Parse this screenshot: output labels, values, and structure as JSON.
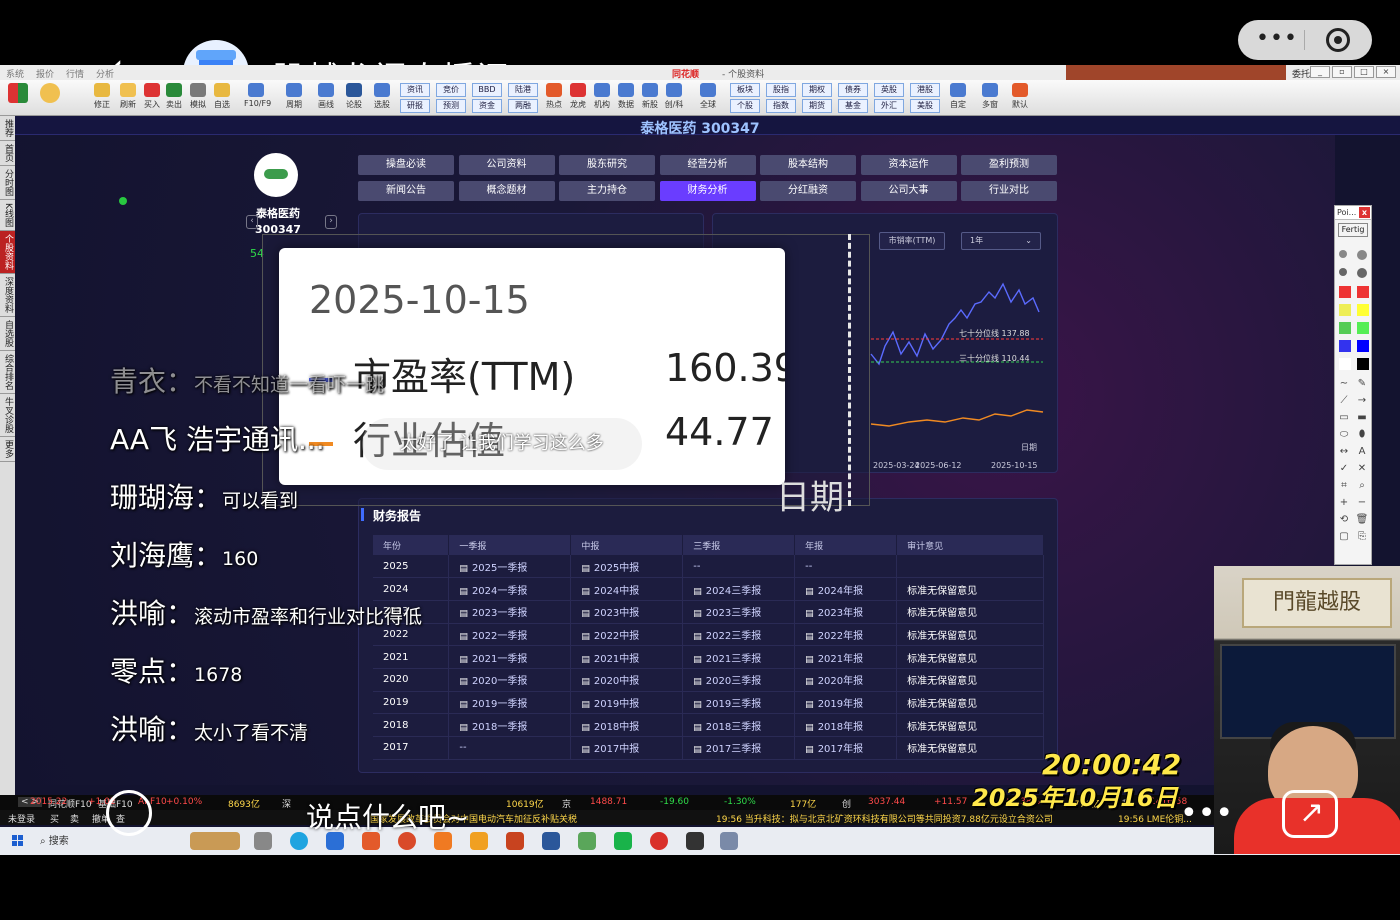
{
  "live": {
    "room_title": "股越龙门直播间",
    "say_prompt": "说点什么吧~",
    "clock_time": "20:00:42",
    "clock_date": "2025年10月16日",
    "cam_plaque": "門龍越股"
  },
  "app": {
    "menu_items": [
      "系统",
      "报价",
      "行情",
      "分析",
      "交易",
      "机会",
      "资讯",
      "工具",
      "期货"
    ],
    "app_name": "同花顺",
    "app_subtitle": "- 个股资料",
    "window_right_label": "委托",
    "toolbar": [
      "修正",
      "刷新",
      "买入",
      "卖出",
      "模拟",
      "自选",
      "F10/F9",
      "周期",
      "画线",
      "论股",
      "选股",
      "热点",
      "龙虎",
      "机构",
      "数据",
      "新股",
      "创/科",
      "全球",
      "自定",
      "多窗",
      "默认"
    ],
    "toolbar_dual": [
      [
        "资讯",
        "研报"
      ],
      [
        "竞价",
        "预测"
      ],
      [
        "BBD",
        "资金"
      ],
      [
        "陆港",
        "两融"
      ],
      [
        "板块",
        "个股"
      ],
      [
        "股指",
        "指数"
      ],
      [
        "期权",
        "期货"
      ],
      [
        "债券",
        "基金"
      ],
      [
        "英股",
        "外汇"
      ],
      [
        "港股",
        "美股"
      ]
    ],
    "left_vbar": [
      "推荐",
      "首页",
      "分时图",
      "K线图",
      "个股资料",
      "深度资料",
      "自选股",
      "综合排名",
      "牛叉诊股",
      "更多"
    ]
  },
  "stock": {
    "title": "泰格医药 300347",
    "name": "泰格医药",
    "code": "300347",
    "logo_text": "Tigermed"
  },
  "tabs": [
    "操盘必读",
    "公司资料",
    "股东研究",
    "经营分析",
    "股本结构",
    "资本运作",
    "盈利预测",
    "新闻公告",
    "概念题材",
    "主力持仓",
    "财务分析",
    "分红融资",
    "公司大事",
    "行业对比"
  ],
  "active_tab": "财务分析",
  "chart": {
    "metric_chip": "市销率(TTM)",
    "range_chip": "1年",
    "pct70_label": "七十分位线 137.88",
    "pct30_label": "三十分位线 110.44",
    "axis_label": "日期",
    "left_tick": "54"
  },
  "chart_data": {
    "type": "line",
    "title": "",
    "x": [
      "2025-03-24",
      "2025-06-12",
      "2025-10-15"
    ],
    "series": [
      {
        "name": "市盈率(TTM)",
        "values": []
      },
      {
        "name": "行业估值",
        "values": []
      }
    ],
    "xlabel": "日期",
    "ylabel": "",
    "tooltip": {
      "date": "2025-10-15",
      "市盈率(TTM)": 160.39,
      "行业估值": 44.77
    },
    "grid": false
  },
  "tooltip": {
    "date": "2025-10-15",
    "row1_label": "市盈率(TTM)",
    "row1_value": "160.39",
    "row2_label": "行业估值",
    "row2_value": "44.77",
    "axis": "日期"
  },
  "report": {
    "title": "财务报告",
    "headers": [
      "年份",
      "一季报",
      "中报",
      "三季报",
      "年报",
      "审计意见"
    ],
    "rows": [
      [
        "2025",
        "2025一季报",
        "2025中报",
        "--",
        "--",
        ""
      ],
      [
        "2024",
        "2024一季报",
        "2024中报",
        "2024三季报",
        "2024年报",
        "标准无保留意见"
      ],
      [
        "2023",
        "2023一季报",
        "2023中报",
        "2023三季报",
        "2023年报",
        "标准无保留意见"
      ],
      [
        "2022",
        "2022一季报",
        "2022中报",
        "2022三季报",
        "2022年报",
        "标准无保留意见"
      ],
      [
        "2021",
        "2021一季报",
        "2021中报",
        "2021三季报",
        "2021年报",
        "标准无保留意见"
      ],
      [
        "2020",
        "2020一季报",
        "2020中报",
        "2020三季报",
        "2020年报",
        "标准无保留意见"
      ],
      [
        "2019",
        "2019一季报",
        "2019中报",
        "2019三季报",
        "2019年报",
        "标准无保留意见"
      ],
      [
        "2018",
        "2018一季报",
        "2018中报",
        "2018三季报",
        "2018年报",
        "标准无保留意见"
      ],
      [
        "2017",
        "--",
        "2017中报",
        "2017三季报",
        "2017年报",
        "标准无保留意见"
      ]
    ]
  },
  "comments": [
    {
      "name": "青衣",
      "text": "不看不知道一看吓一跳"
    },
    {
      "name": "AA飞 浩宇通讯...",
      "text": ""
    },
    {
      "name": "珊瑚海",
      "text": "可以看到"
    },
    {
      "name": "刘海鹰",
      "text": "160"
    },
    {
      "name": "洪喻",
      "text": "滚动市盈率和行业对比得低"
    },
    {
      "name": "零点",
      "text": "1678"
    },
    {
      "name": "洪喻",
      "text": "太小了看不清"
    }
  ],
  "bubble_text": "太好了 让我们学习这么多",
  "ticker": {
    "tabs": [
      "同花顺F10",
      "基础F10",
      "AI-F10"
    ],
    "items1": [
      "2015.22",
      "+1.02",
      "+0.10%",
      "8693亿",
      "深",
      "10619亿",
      "京",
      "1488.71",
      "-19.60",
      "-1.30%",
      "177亿",
      "创",
      "3037.44",
      "+11.57",
      "+0.38%",
      "4776亿",
      "科",
      "1416.58"
    ],
    "items2": [
      "未登录",
      "买",
      "卖",
      "撤单",
      "查"
    ],
    "news": "国家发展改革委员会对中国电动汽车加征反补贴关税",
    "news2": "19:56 当升科技：拟与北京北矿资环科技有限公司等共同投资7.88亿元设立合资公司",
    "news3": "19:56 LME伦铜..."
  },
  "taskbar": {
    "search": "搜索"
  },
  "toolbox": {
    "header": "Poi...",
    "close": "x",
    "button": "Fertig"
  }
}
